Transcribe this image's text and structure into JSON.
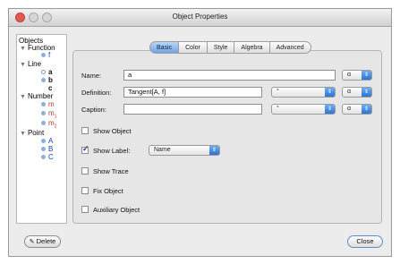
{
  "window": {
    "title": "Object Properties"
  },
  "tree": {
    "header": "Objects",
    "groups": [
      {
        "label": "Function",
        "items": [
          {
            "name": "f",
            "color": "#1a3fb6",
            "bold": false
          }
        ]
      },
      {
        "label": "Line",
        "items": [
          {
            "name": "a",
            "color": "#111111",
            "bold": true
          },
          {
            "name": "b",
            "color": "#111111",
            "bold": true
          },
          {
            "name": "c",
            "color": "#111111",
            "bold": true
          }
        ]
      },
      {
        "label": "Number",
        "items": [
          {
            "name": "m",
            "color": "#b43a2e"
          },
          {
            "name": "m",
            "sub": "1",
            "color": "#b43a2e"
          },
          {
            "name": "m",
            "sub": "2",
            "color": "#b43a2e"
          }
        ]
      },
      {
        "label": "Point",
        "items": [
          {
            "name": "A",
            "color": "#1a3fb6"
          },
          {
            "name": "B",
            "color": "#1a3fb6"
          },
          {
            "name": "C",
            "color": "#1a3fb6"
          }
        ]
      }
    ]
  },
  "tabs": [
    "Basic",
    "Color",
    "Style",
    "Algebra",
    "Advanced"
  ],
  "active_tab": "Basic",
  "basic": {
    "name_label": "Name:",
    "name_value": "a",
    "definition_label": "Definition:",
    "definition_value": "Tangent[A, f]",
    "caption_label": "Caption:",
    "caption_value": "",
    "symbol_select": "°",
    "alpha_select": "α",
    "show_object": "Show Object",
    "show_label": "Show Label:",
    "label_mode": "Name",
    "show_trace": "Show Trace",
    "fix_object": "Fix Object",
    "auxiliary_object": "Auxiliary Object"
  },
  "buttons": {
    "delete": "Delete",
    "close": "Close"
  },
  "colors": {
    "accent": "#2e74cf",
    "close_traffic": "#e25a4e"
  }
}
